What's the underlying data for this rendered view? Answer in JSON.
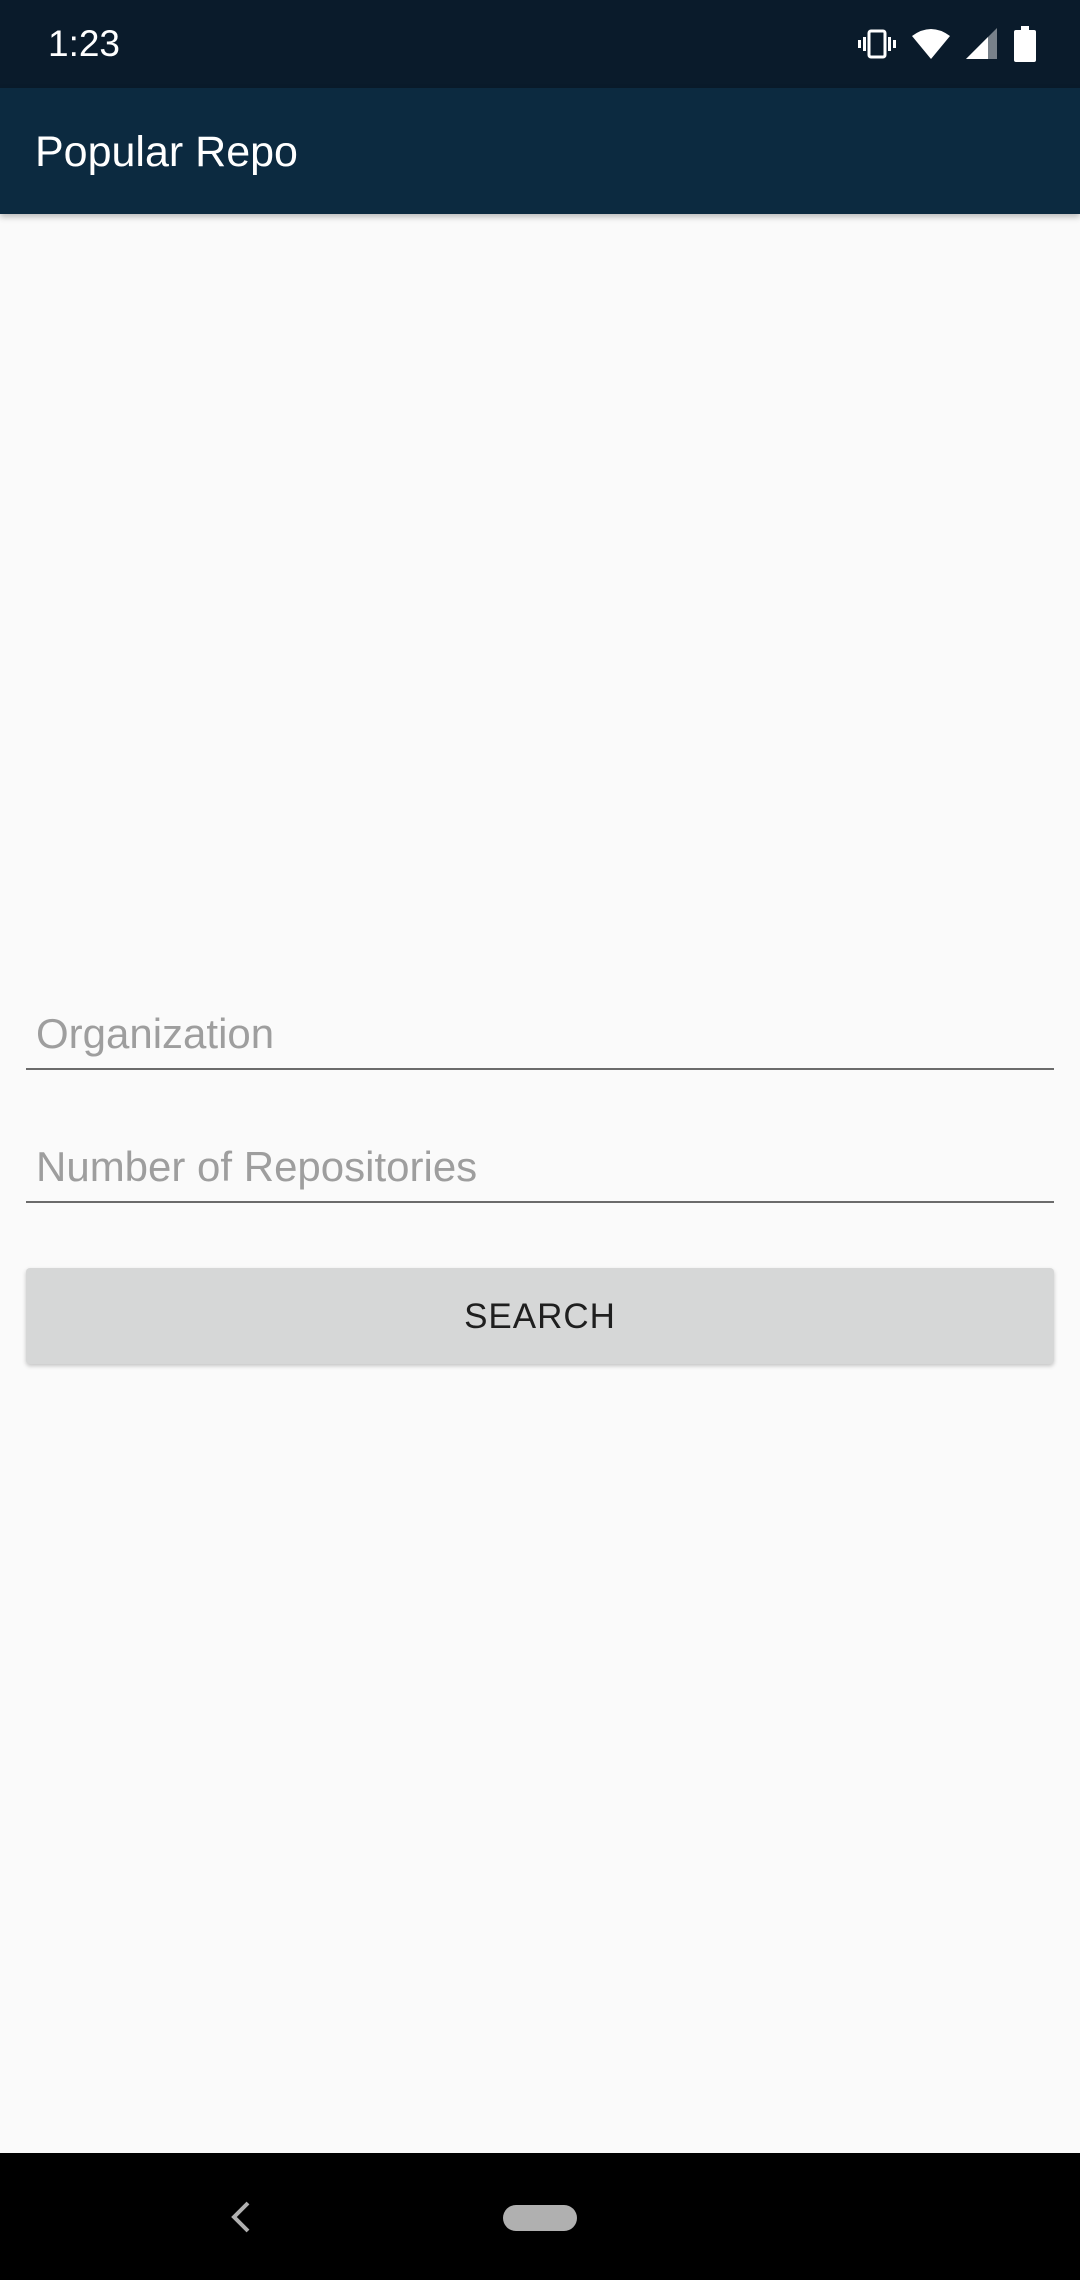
{
  "status_bar": {
    "time": "1:23",
    "icons": [
      "vibrate-icon",
      "wifi-icon",
      "signal-icon",
      "battery-icon"
    ]
  },
  "app_bar": {
    "title": "Popular Repo",
    "color": "#0c2a40"
  },
  "form": {
    "organization": {
      "placeholder": "Organization",
      "value": ""
    },
    "repositories": {
      "placeholder": "Number of Repositories",
      "value": ""
    },
    "search_label": "SEARCH"
  },
  "nav_bar": {
    "icons": [
      "back-icon",
      "home-pill-icon"
    ]
  },
  "colors": {
    "status_bar": "#0a1b2b",
    "background": "#fafafa",
    "button": "#d6d7d7"
  }
}
